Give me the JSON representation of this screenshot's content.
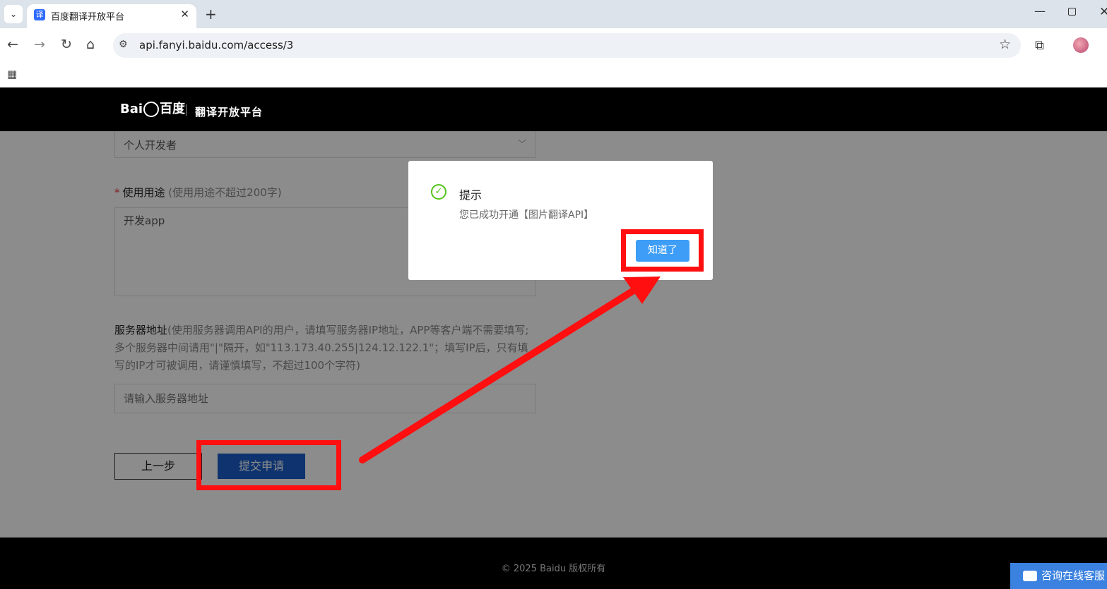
{
  "browser": {
    "tab_title": "百度翻译开放平台",
    "tab_favicon": "译",
    "url": "api.fanyi.baidu.com/access/3",
    "icons": [
      "tab-search-icon",
      "favicon",
      "close-icon",
      "plus-icon",
      "minimize-icon",
      "maximize-icon",
      "close-window-icon",
      "back-icon",
      "forward-icon",
      "reload-icon",
      "home-icon",
      "site-settings-icon",
      "star-icon",
      "extensions-icon",
      "profile-avatar",
      "menu-icon",
      "apps-icon"
    ]
  },
  "header": {
    "logo_text_en": "Bai",
    "logo_text_cn": "百度",
    "platform": "翻译开放平台"
  },
  "form": {
    "developer_type": "个人开发者",
    "usage_label": "使用用途",
    "usage_hint": "(使用用途不超过200字)",
    "usage_value": "开发app",
    "server_label": "服务器地址",
    "server_hint": "(使用服务器调用API的用户，请填写服务器IP地址，APP等客户端不需要填写;多个服务器中间请用\"|\"隔开，如\"113.173.40.255|124.12.122.1\"；填写IP后，只有填写的IP才可被调用，请谨慎填写，不超过100个字符)",
    "server_placeholder": "请输入服务器地址",
    "prev_button": "上一步",
    "submit_button": "提交申请"
  },
  "dialog": {
    "title": "提示",
    "message": "您已成功开通【图片翻译API】",
    "ok_button": "知道了"
  },
  "footer": {
    "copyright": "© 2025 Baidu 版权所有",
    "chat_button": "咨询在线客服"
  },
  "colors": {
    "annotation": "#ff0f0f",
    "submit": "#1a5ec8",
    "ok": "#3e9ef7",
    "success": "#52c41a"
  }
}
